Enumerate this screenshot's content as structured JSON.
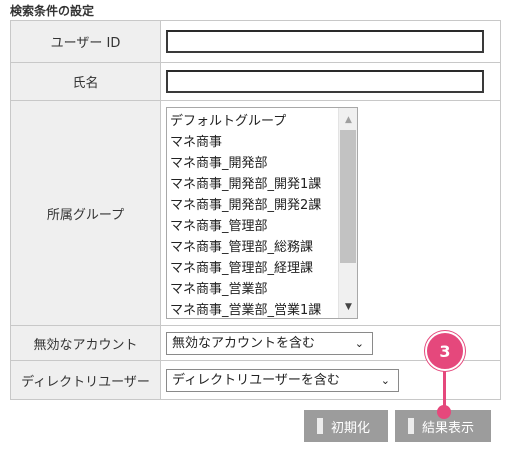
{
  "section_title": "検索条件の設定",
  "fields": {
    "user_id_label": "ユーザー ID",
    "user_id_value": "",
    "name_label": "氏名",
    "name_value": "",
    "group_label": "所属グループ",
    "groups": [
      "デフォルトグループ",
      "マネ商事",
      "マネ商事_開発部",
      "マネ商事_開発部_開発1課",
      "マネ商事_開発部_開発2課",
      "マネ商事_管理部",
      "マネ商事_管理部_総務課",
      "マネ商事_管理部_経理課",
      "マネ商事_営業部",
      "マネ商事_営業部_営業1課"
    ],
    "disabled_account_label": "無効なアカウント",
    "disabled_account_selected": "無効なアカウントを含む",
    "directory_user_label": "ディレクトリユーザー",
    "directory_user_selected": "ディレクトリユーザーを含む"
  },
  "buttons": {
    "reset_label": "初期化",
    "search_label": "結果表示"
  },
  "callout": {
    "number": "3",
    "color": "#e5487c"
  },
  "icons": {
    "scroll_up": "triangle-up-icon",
    "scroll_down": "triangle-down-icon",
    "select_chevron": "chevron-down-icon"
  }
}
